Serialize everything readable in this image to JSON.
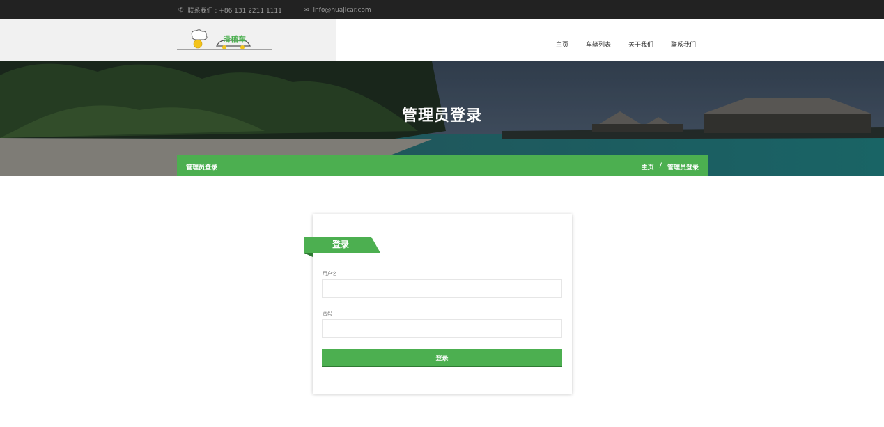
{
  "topbar": {
    "phone_icon": "phone-icon",
    "phone_text": "联系我们 : +86 131 2211 1111",
    "separator": "|",
    "email_icon": "envelope-icon",
    "email_text": "info@huajicar.com"
  },
  "header": {
    "logo_text": "滑稽车",
    "nav": [
      "主页",
      "车辆列表",
      "关于我们",
      "联系我们"
    ]
  },
  "hero": {
    "title": "管理员登录",
    "crumb_left": "管理员登录",
    "crumb_home": "主页",
    "crumb_sep": "/",
    "crumb_current": "管理员登录"
  },
  "login": {
    "heading": "登录",
    "username_label": "用户名",
    "username_value": "",
    "password_label": "密码",
    "password_value": "",
    "submit_label": "登录"
  },
  "colors": {
    "accent": "#4caf50",
    "topbar": "#222222"
  }
}
